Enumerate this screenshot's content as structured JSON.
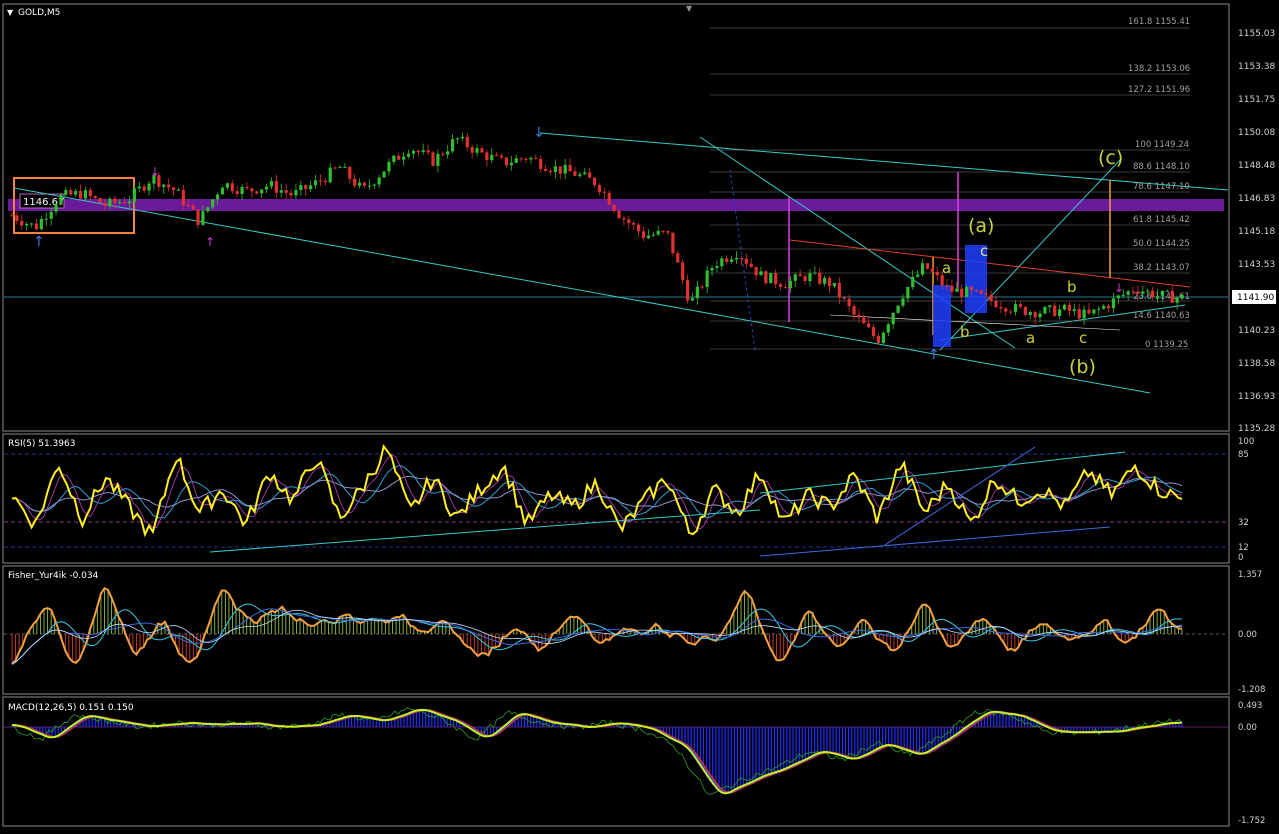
{
  "window": {
    "symbol_label": "GOLD,M5"
  },
  "main_panel": {
    "price_axis": [
      "1155.03",
      "1153.38",
      "1151.75",
      "1150.08",
      "1148.48",
      "1146.83",
      "1145.18",
      "1143.53",
      "1141.90",
      "1140.23",
      "1138.58",
      "1136.93",
      "1135.28"
    ],
    "current_price": "1141.90",
    "box_price_label": "1146.67",
    "fib_levels": [
      "161.8 1155.41",
      "138.2 1153.06",
      "127.2 1151.96",
      "100 1149.24",
      "88.6 1148.10",
      "78.6 1147.10",
      "61.8 1145.42",
      "50.0 1144.25",
      "38.2 1143.07",
      "23.6 1141.61",
      "14.6 1140.63",
      "0 1139.25"
    ],
    "wave_labels": [
      "(c)",
      "(a)",
      "c",
      "a",
      "b",
      "b",
      "a",
      "c",
      "(b)"
    ],
    "colors": {
      "bull": "#2fbf2f",
      "bear": "#e03030",
      "purple_zone": "#6a1b9a",
      "trendline": "#36c9c9",
      "wave_label": "#c8d23a",
      "box": "#ff7f3f"
    }
  },
  "rsi_panel": {
    "title": "RSI(5) 51.3963",
    "levels": [
      "100",
      "85",
      "32",
      "12",
      "0"
    ]
  },
  "fisher_panel": {
    "title": "Fisher_Yur4ik -0.034",
    "levels": [
      "1.357",
      "0.00",
      "-1.208"
    ]
  },
  "macd_panel": {
    "title": "MACD(12,26,5) 0.151 0.150",
    "levels": [
      "0.493",
      "0.00",
      "-1.752"
    ]
  },
  "chart_data": {
    "type": "candlestick",
    "title": "GOLD,M5",
    "close_path": [
      1146.0,
      1145.4,
      1146.9,
      1147.1,
      1146.5,
      1146.8,
      1147.9,
      1147.2,
      1145.7,
      1147.6,
      1147.2,
      1147.5,
      1147.0,
      1147.6,
      1148.4,
      1147.2,
      1148.4,
      1149.4,
      1148.7,
      1149.8,
      1149.1,
      1148.6,
      1148.9,
      1148.4,
      1148.1,
      1147.6,
      1146.0,
      1145.0,
      1145.1,
      1141.6,
      1143.6,
      1144.2,
      1143.0,
      1142.6,
      1143.0,
      1142.6,
      1141.0,
      1139.8,
      1142.0,
      1143.5,
      1142.3,
      1142.1,
      1141.7,
      1141.3,
      1141.2,
      1141.3,
      1141.0,
      1141.7,
      1142.4,
      1142.0,
      1141.9
    ],
    "ylim": [
      1135.28,
      1156.5
    ],
    "rsi_values": [
      55,
      30,
      82,
      35,
      70,
      45,
      20,
      90,
      40,
      60,
      30,
      75,
      50,
      88,
      35,
      62,
      95,
      40,
      70,
      35,
      60,
      80,
      30,
      55,
      45,
      66,
      25,
      50,
      70,
      20,
      60,
      40,
      75,
      30,
      55,
      45,
      72,
      35,
      82,
      40,
      65,
      30,
      70,
      50,
      60,
      45,
      75,
      55,
      80,
      60,
      51.4
    ],
    "fisher_values": [
      -0.5,
      0.8,
      -1.0,
      1.2,
      -0.6,
      0.4,
      -0.9,
      1.0,
      0.3,
      0.6,
      0.2,
      0.5,
      0.3,
      0.4,
      0.2,
      0.0,
      -0.6,
      0.3,
      -0.4,
      0.6,
      -0.3,
      0.2,
      0.1,
      -0.2,
      0.0,
      1.1,
      -0.8,
      0.5,
      -0.3,
      0.4,
      -0.6,
      0.9,
      -0.5,
      0.5,
      -0.4,
      0.2,
      -0.1,
      0.3,
      -0.2,
      0.6,
      -0.034
    ],
    "macd_values": [
      0.05,
      -0.3,
      0.3,
      0.15,
      0.0,
      0.1,
      0.05,
      0.1,
      0.0,
      0.05,
      0.3,
      0.15,
      0.45,
      0.2,
      -0.3,
      0.35,
      0.1,
      0.0,
      0.1,
      -0.05,
      -0.5,
      -1.7,
      -1.3,
      -1.0,
      -0.6,
      -0.8,
      -0.4,
      -0.7,
      -0.2,
      0.4,
      0.3,
      -0.1,
      -0.15,
      -0.1,
      0.05,
      0.151
    ]
  }
}
